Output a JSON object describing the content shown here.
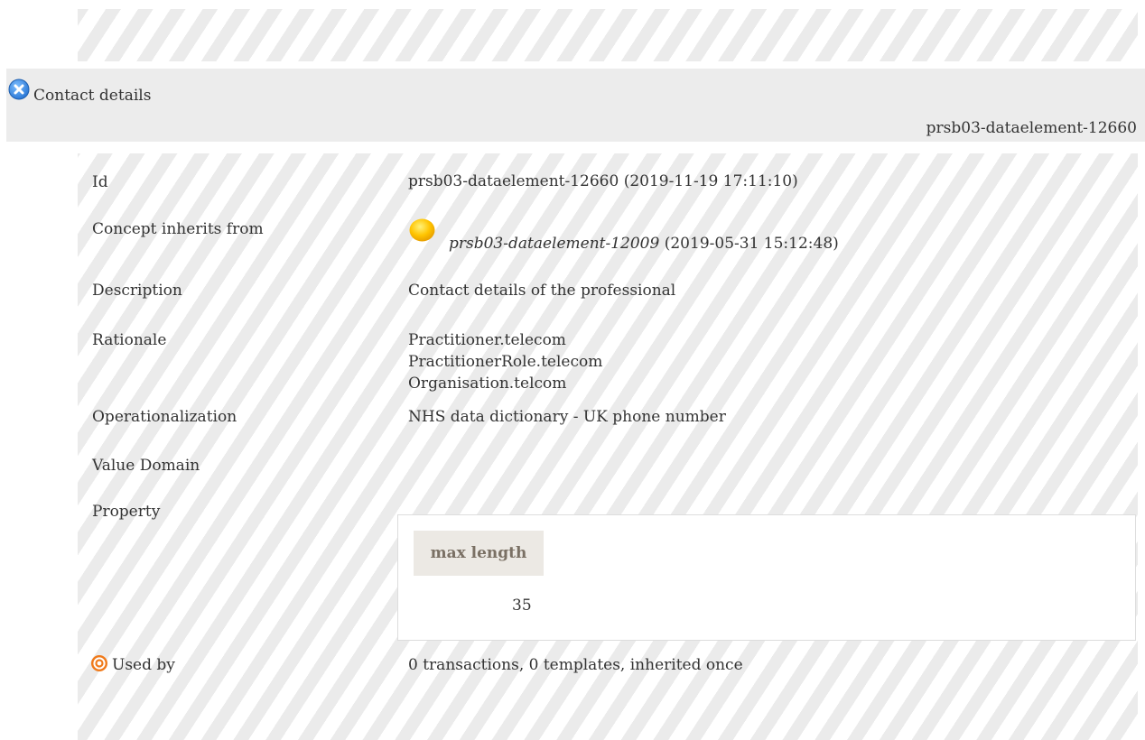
{
  "header": {
    "title": "Contact details",
    "id": "prsb03-dataelement-12660"
  },
  "fields": {
    "id": {
      "label": "Id",
      "value": "prsb03-dataelement-12660 (2019-11-19 17:11:10)"
    },
    "inherits": {
      "label": "Concept inherits from",
      "id": "prsb03-dataelement-12009",
      "date": "(2019-05-31 15:12:48)"
    },
    "description": {
      "label": "Description",
      "value": "Contact details of the professional"
    },
    "rationale": {
      "label": "Rationale",
      "lines": [
        "Practitioner.telecom",
        "PractitionerRole.telecom",
        "Organisation.telcom"
      ]
    },
    "operationalization": {
      "label": "Operationalization",
      "value": "NHS data dictionary - UK phone number"
    },
    "value_domain": {
      "label": "Value Domain"
    },
    "property": {
      "label": "Property",
      "header": "max length",
      "value": "35"
    },
    "used_by": {
      "label": "Used by",
      "value": "0 transactions, 0 templates, inherited once"
    }
  },
  "icons": {
    "close": "close-icon",
    "status": "status-sun-icon",
    "used_by": "target-icon"
  },
  "colors": {
    "close_icon": "#3a8ee6",
    "status_icon": "#f6b400",
    "used_by_icon": "#f07a1a",
    "property_header_bg": "#ece9e4",
    "property_header_text": "#7a7064"
  }
}
